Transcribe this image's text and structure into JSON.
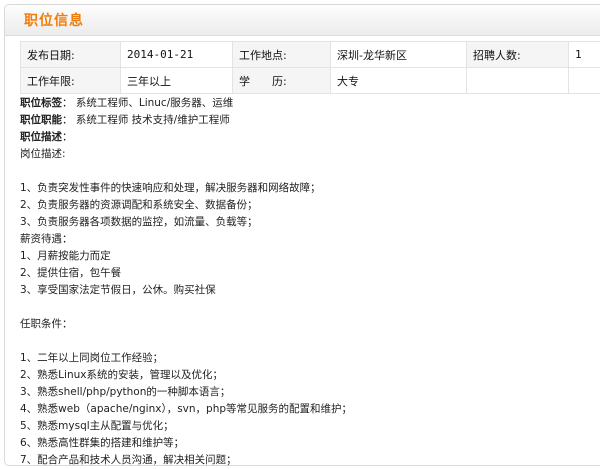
{
  "section": {
    "title": "职位信息"
  },
  "info": {
    "publish_date_label": "发布日期:",
    "publish_date": "2014-01-21",
    "location_label": "工作地点:",
    "location": "深圳-龙华新区",
    "headcount_label": "招聘人数:",
    "headcount": "1",
    "experience_label": "工作年限:",
    "experience": "三年以上",
    "education_label": "学　　历:",
    "education": "大专"
  },
  "tags": {
    "label": "职位标签",
    "value": "系统工程师、Linuc/服务器、运维",
    "function_label": "职位职能",
    "function_value": "系统工程师   技术支持/维护工程师",
    "desc_label": "职位描述"
  },
  "description": {
    "lines": [
      "岗位描述:",
      "",
      "1、负责突发性事件的快速响应和处理，解决服务器和网络故障；",
      "2、负责服务器的资源调配和系统安全、数据备份；",
      "3、负责服务器各项数据的监控，如流量、负载等；",
      "薪资待遇：",
      "1、月薪按能力而定",
      "2、提供住宿，包午餐",
      "3、享受国家法定节假日，公休。购买社保",
      "",
      "任职条件：",
      "",
      "1、二年以上同岗位工作经验；",
      "2、熟悉Linux系统的安装，管理以及优化；",
      "3、熟悉shell/php/python的一种脚本语言；",
      "4、熟悉web（apache/nginx），svn，php等常见服务的配置和维护；",
      "5、熟悉mysql主从配置与优化；",
      "6、熟悉高性群集的搭建和维护等；",
      "7、配合产品和技术人员沟通，解决相关问题；"
    ]
  }
}
